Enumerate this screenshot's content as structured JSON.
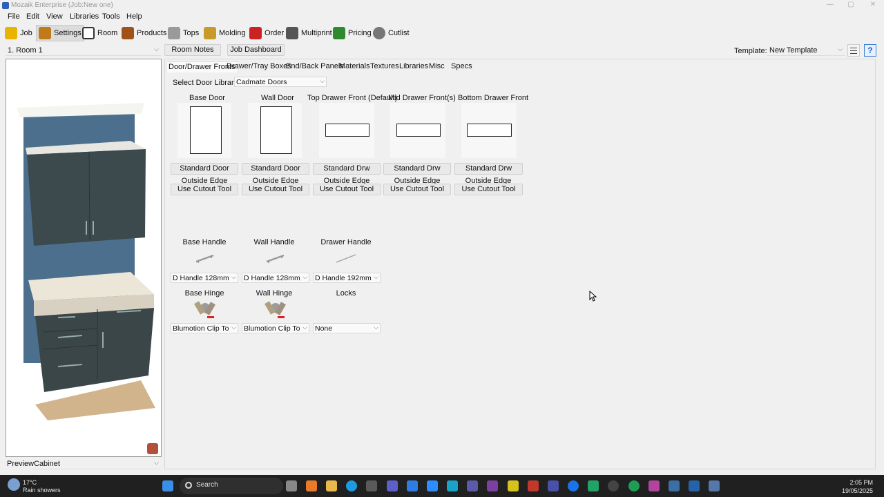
{
  "window": {
    "title": "Mozaik Enterprise (Job:New one)"
  },
  "menu": [
    "File",
    "Edit",
    "View",
    "Libraries",
    "Tools",
    "Help"
  ],
  "toolbar": [
    {
      "label": "Job",
      "icon": "hardhat-icon",
      "color": "#e8b400"
    },
    {
      "label": "Settings",
      "icon": "settings-book-icon",
      "color": "#c07a1a"
    },
    {
      "label": "Room",
      "icon": "room-icon",
      "color": "#333333"
    },
    {
      "label": "Products",
      "icon": "products-icon",
      "color": "#a0521a"
    },
    {
      "label": "Tops",
      "icon": "tops-icon",
      "color": "#9a9a9a"
    },
    {
      "label": "Molding",
      "icon": "molding-icon",
      "color": "#c89a2a"
    },
    {
      "label": "Order",
      "icon": "order-icon",
      "color": "#cc2222"
    },
    {
      "label": "Multiprint",
      "icon": "multiprint-icon",
      "color": "#555555"
    },
    {
      "label": "Pricing",
      "icon": "pricing-icon",
      "color": "#2f8a2f"
    },
    {
      "label": "Cutlist",
      "icon": "cutlist-icon",
      "color": "#777777"
    }
  ],
  "room_select": {
    "value": "1. Room 1"
  },
  "buttons": {
    "room_notes": "Room Notes",
    "job_dashboard": "Job Dashboard"
  },
  "template": {
    "label": "Template:",
    "value": "New Template"
  },
  "tabs": [
    "Door/Drawer Fronts",
    "Drawer/Tray Boxes",
    "End/Back Panels",
    "Materials",
    "Textures",
    "Libraries",
    "Misc",
    "Specs"
  ],
  "door_library": {
    "label": "Select Door Library",
    "value": "Cadmate Doors"
  },
  "fronts": [
    {
      "header": "Base Door",
      "style": "Standard Door",
      "edge": "Outside Edge",
      "cutout": "Use Cutout Tool"
    },
    {
      "header": "Wall Door",
      "style": "Standard Door",
      "edge": "Outside Edge",
      "cutout": "Use Cutout Tool"
    },
    {
      "header": "Top Drawer Front (Default)",
      "style": "Standard Drw",
      "edge": "Outside Edge",
      "cutout": "Use Cutout Tool"
    },
    {
      "header": "Mid Drawer Front(s)",
      "style": "Standard Drw",
      "edge": "Outside Edge",
      "cutout": "Use Cutout Tool"
    },
    {
      "header": "Bottom Drawer Front",
      "style": "Standard Drw",
      "edge": "Outside Edge",
      "cutout": "Use Cutout Tool"
    }
  ],
  "handles": [
    {
      "label": "Base Handle",
      "value": "D Handle 128mm"
    },
    {
      "label": "Wall Handle",
      "value": "D Handle 128mm"
    },
    {
      "label": "Drawer Handle",
      "value": "D Handle 192mm"
    }
  ],
  "hardware": [
    {
      "label": "Base Hinge",
      "value": "Blumotion Clip Top (A"
    },
    {
      "label": "Wall Hinge",
      "value": "Blumotion Clip Top (A"
    },
    {
      "label": "Locks",
      "value": "None"
    }
  ],
  "preview": {
    "label": "Preview",
    "value": "Cabinet"
  },
  "taskbar": {
    "weather_temp": "17°C",
    "weather_desc": "Rain showers",
    "search": "Search",
    "time": "2:05 PM",
    "date": "19/05/2025"
  }
}
